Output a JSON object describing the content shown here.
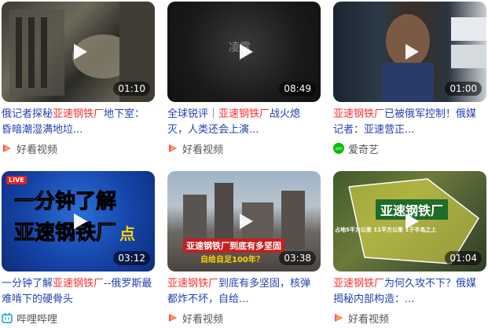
{
  "cards": [
    {
      "duration": "01:10",
      "title_prefix": "俄记者探秘",
      "title_highlight": "亚速钢铁厂",
      "title_suffix": "地下室：昏暗潮湿满地垃...",
      "source": "好看视频",
      "source_icon": "haokan-logo-icon"
    },
    {
      "duration": "08:49",
      "title_prefix": "全球锐评｜",
      "title_highlight": "亚速钢铁厂",
      "title_suffix": "战火熄灭，人类还会上演...",
      "source": "好看视频",
      "source_icon": "haokan-logo-icon",
      "thumb_text": "凌霄"
    },
    {
      "duration": "01:00",
      "title_prefix": "",
      "title_highlight": "亚速钢铁厂",
      "title_suffix": "已被俄军控制！俄媒记者：亚速营正...",
      "source": "爱奇艺",
      "source_icon": "iqiyi-logo-icon",
      "source_icon_text": "iQIYI"
    },
    {
      "duration": "03:12",
      "title_prefix": "一分钟了解",
      "title_highlight": "亚速钢铁厂",
      "title_suffix": "--俄罗斯最难啃下的硬骨头",
      "source": "哔哩哔哩",
      "source_icon": "bilibili-logo-icon",
      "thumb_live": "LIVE",
      "thumb_line1": "一分钟了解",
      "thumb_line2": "亚速钢铁厂",
      "thumb_suffix": "点"
    },
    {
      "duration": "03:38",
      "title_prefix": "",
      "title_highlight": "亚速钢铁厂",
      "title_suffix": "到底有多坚固，核弹都炸不坏，自给...",
      "source": "好看视频",
      "source_icon": "haokan-logo-icon",
      "thumb_caption1": "亚速钢铁厂到底有多坚固",
      "thumb_caption2": "自给自足100年？"
    },
    {
      "duration": "01:04",
      "title_prefix": "",
      "title_highlight": "亚速钢铁厂",
      "title_suffix": "为何久攻不下？俄媒揭秘内部构造：...",
      "source": "好看视频",
      "source_icon": "haokan-logo-icon",
      "thumb_banner": "亚速钢铁厂",
      "thumb_note": "占地5平方公里 11平方公里 1于半岛之上"
    }
  ],
  "colors": {
    "link": "#2440b3",
    "highlight": "#f73131",
    "source_text": "#555555"
  }
}
